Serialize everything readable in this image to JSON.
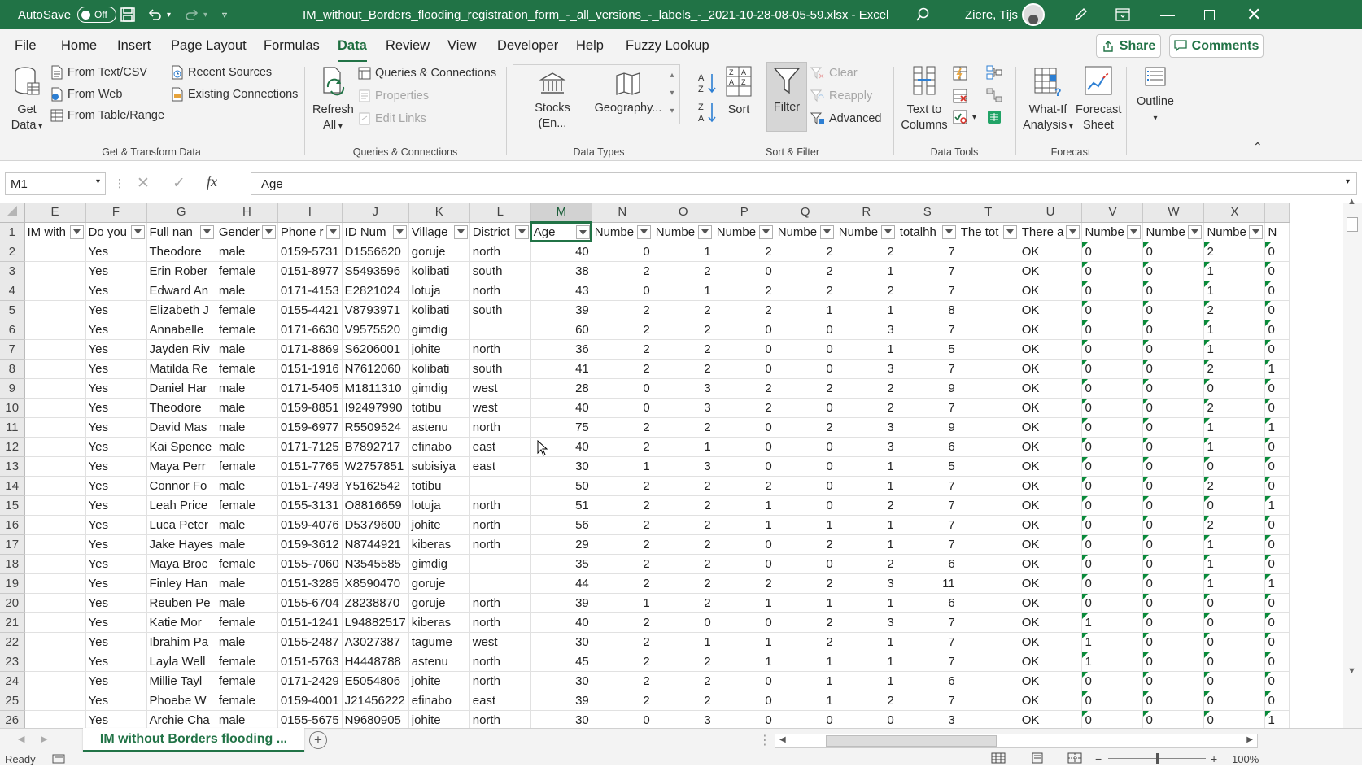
{
  "titlebar": {
    "autosave_label": "AutoSave",
    "autosave_state": "Off",
    "title": "IM_without_Borders_flooding_registration_form_-_all_versions_-_labels_-_2021-10-28-08-05-59.xlsx  -  Excel",
    "user": "Ziere, Tijs"
  },
  "menu": {
    "file": "File",
    "home": "Home",
    "insert": "Insert",
    "page_layout": "Page Layout",
    "formulas": "Formulas",
    "data": "Data",
    "review": "Review",
    "view": "View",
    "developer": "Developer",
    "help": "Help",
    "fuzzy": "Fuzzy Lookup",
    "share": "Share",
    "comments": "Comments"
  },
  "ribbon": {
    "get_data": [
      "Get",
      "Data"
    ],
    "from_text": "From Text/CSV",
    "from_web": "From Web",
    "from_table": "From Table/Range",
    "recent_sources": "Recent Sources",
    "existing_connections": "Existing Connections",
    "group_get": "Get & Transform Data",
    "refresh": [
      "Refresh",
      "All"
    ],
    "queries": "Queries & Connections",
    "properties": "Properties",
    "edit_links": "Edit Links",
    "group_queries": "Queries & Connections",
    "stocks": "Stocks (En...",
    "geography": "Geography...",
    "group_types": "Data Types",
    "sort": "Sort",
    "filter": "Filter",
    "clear": "Clear",
    "reapply": "Reapply",
    "advanced": "Advanced",
    "group_sort": "Sort & Filter",
    "text_to_columns": [
      "Text to",
      "Columns"
    ],
    "group_tools": "Data Tools",
    "what_if": [
      "What-If",
      "Analysis"
    ],
    "forecast_sheet": [
      "Forecast",
      "Sheet"
    ],
    "group_forecast": "Forecast",
    "outline": "Outline"
  },
  "formula_bar": {
    "name_box": "M1",
    "content": "Age"
  },
  "sheet": {
    "columns": [
      "E",
      "F",
      "G",
      "H",
      "I",
      "J",
      "K",
      "L",
      "M",
      "N",
      "O",
      "P",
      "Q",
      "R",
      "S",
      "T",
      "U",
      "V",
      "W",
      "X"
    ],
    "headers": [
      "IM with",
      "Do you",
      "Full nan",
      "Gender",
      "Phone r",
      "ID Num",
      "Village",
      "District",
      "Age",
      "Numbe",
      "Numbe",
      "Numbe",
      "Numbe",
      "Numbe",
      "totalhh",
      "The tot",
      "There a",
      "Numbe",
      "Numbe",
      "Numbe",
      "N"
    ],
    "rows": [
      {
        "n": "2",
        "c": [
          "",
          "Yes",
          "Theodore",
          "male",
          "0159-5731",
          "D1556620",
          "goruje",
          "north",
          "40",
          "0",
          "1",
          "2",
          "2",
          "2",
          "7",
          "",
          "OK",
          "0",
          "0",
          "2",
          "0"
        ]
      },
      {
        "n": "3",
        "c": [
          "",
          "Yes",
          "Erin Rober",
          "female",
          "0151-8977",
          "S5493596",
          "kolibati",
          "south",
          "38",
          "2",
          "2",
          "0",
          "2",
          "1",
          "7",
          "",
          "OK",
          "0",
          "0",
          "1",
          "0"
        ]
      },
      {
        "n": "4",
        "c": [
          "",
          "Yes",
          "Edward An",
          "male",
          "0171-4153",
          "E2821024",
          "lotuja",
          "north",
          "43",
          "0",
          "1",
          "2",
          "2",
          "2",
          "7",
          "",
          "OK",
          "0",
          "0",
          "1",
          "0"
        ]
      },
      {
        "n": "5",
        "c": [
          "",
          "Yes",
          "Elizabeth J",
          "female",
          "0155-4421",
          "V8793971",
          "kolibati",
          "south",
          "39",
          "2",
          "2",
          "2",
          "1",
          "1",
          "8",
          "",
          "OK",
          "0",
          "0",
          "2",
          "0"
        ]
      },
      {
        "n": "6",
        "c": [
          "",
          "Yes",
          "Annabelle",
          "female",
          "0171-6630",
          "V9575520",
          "gimdig",
          "",
          "60",
          "2",
          "2",
          "0",
          "0",
          "3",
          "7",
          "",
          "OK",
          "0",
          "0",
          "1",
          "0"
        ]
      },
      {
        "n": "7",
        "c": [
          "",
          "Yes",
          "Jayden Riv",
          "male",
          "0171-8869",
          "S6206001",
          "johite",
          "north",
          "36",
          "2",
          "2",
          "0",
          "0",
          "1",
          "5",
          "",
          "OK",
          "0",
          "0",
          "1",
          "0"
        ]
      },
      {
        "n": "8",
        "c": [
          "",
          "Yes",
          "Matilda Re",
          "female",
          "0151-1916",
          "N7612060",
          "kolibati",
          "south",
          "41",
          "2",
          "2",
          "0",
          "0",
          "3",
          "7",
          "",
          "OK",
          "0",
          "0",
          "2",
          "1"
        ]
      },
      {
        "n": "9",
        "c": [
          "",
          "Yes",
          "Daniel Har",
          "male",
          "0171-5405",
          "M1811310",
          "gimdig",
          "west",
          "28",
          "0",
          "3",
          "2",
          "2",
          "2",
          "9",
          "",
          "OK",
          "0",
          "0",
          "0",
          "0"
        ]
      },
      {
        "n": "10",
        "c": [
          "",
          "Yes",
          "Theodore",
          "male",
          "0159-8851",
          "I92497990",
          "totibu",
          "west",
          "40",
          "0",
          "3",
          "2",
          "0",
          "2",
          "7",
          "",
          "OK",
          "0",
          "0",
          "2",
          "0"
        ]
      },
      {
        "n": "11",
        "c": [
          "",
          "Yes",
          "David Mas",
          "male",
          "0159-6977",
          "R5509524",
          "astenu",
          "north",
          "75",
          "2",
          "2",
          "0",
          "2",
          "3",
          "9",
          "",
          "OK",
          "0",
          "0",
          "1",
          "1"
        ]
      },
      {
        "n": "12",
        "c": [
          "",
          "Yes",
          "Kai Spence",
          "male",
          "0171-7125",
          "B7892717",
          "efinabo",
          "east",
          "40",
          "2",
          "1",
          "0",
          "0",
          "3",
          "6",
          "",
          "OK",
          "0",
          "0",
          "1",
          "0"
        ]
      },
      {
        "n": "13",
        "c": [
          "",
          "Yes",
          "Maya Perr",
          "female",
          "0151-7765",
          "W2757851",
          "subisiya",
          "east",
          "30",
          "1",
          "3",
          "0",
          "0",
          "1",
          "5",
          "",
          "OK",
          "0",
          "0",
          "0",
          "0"
        ]
      },
      {
        "n": "14",
        "c": [
          "",
          "Yes",
          "Connor Fo",
          "male",
          "0151-7493",
          "Y5162542",
          "totibu",
          "",
          "50",
          "2",
          "2",
          "2",
          "0",
          "1",
          "7",
          "",
          "OK",
          "0",
          "0",
          "2",
          "0"
        ]
      },
      {
        "n": "15",
        "c": [
          "",
          "Yes",
          "Leah Price",
          "female",
          "0155-3131",
          "O8816659",
          "lotuja",
          "north",
          "51",
          "2",
          "2",
          "1",
          "0",
          "2",
          "7",
          "",
          "OK",
          "0",
          "0",
          "0",
          "1"
        ]
      },
      {
        "n": "16",
        "c": [
          "",
          "Yes",
          "Luca Peter",
          "male",
          "0159-4076",
          "D5379600",
          "johite",
          "north",
          "56",
          "2",
          "2",
          "1",
          "1",
          "1",
          "7",
          "",
          "OK",
          "0",
          "0",
          "2",
          "0"
        ]
      },
      {
        "n": "17",
        "c": [
          "",
          "Yes",
          "Jake Hayes",
          "male",
          "0159-3612",
          "N8744921",
          "kiberas",
          "north",
          "29",
          "2",
          "2",
          "0",
          "2",
          "1",
          "7",
          "",
          "OK",
          "0",
          "0",
          "1",
          "0"
        ]
      },
      {
        "n": "18",
        "c": [
          "",
          "Yes",
          "Maya Broc",
          "female",
          "0155-7060",
          "N3545585",
          "gimdig",
          "",
          "35",
          "2",
          "2",
          "0",
          "0",
          "2",
          "6",
          "",
          "OK",
          "0",
          "0",
          "1",
          "0"
        ]
      },
      {
        "n": "19",
        "c": [
          "",
          "Yes",
          "Finley Han",
          "male",
          "0151-3285",
          "X8590470",
          "goruje",
          "",
          "44",
          "2",
          "2",
          "2",
          "2",
          "3",
          "11",
          "",
          "OK",
          "0",
          "0",
          "1",
          "1"
        ]
      },
      {
        "n": "20",
        "c": [
          "",
          "Yes",
          "Reuben Pe",
          "male",
          "0155-6704",
          "Z8238870",
          "goruje",
          "north",
          "39",
          "1",
          "2",
          "1",
          "1",
          "1",
          "6",
          "",
          "OK",
          "0",
          "0",
          "0",
          "0"
        ]
      },
      {
        "n": "21",
        "c": [
          "",
          "Yes",
          "Katie Mor",
          "female",
          "0151-1241",
          "L94882517",
          "kiberas",
          "north",
          "40",
          "2",
          "0",
          "0",
          "2",
          "3",
          "7",
          "",
          "OK",
          "1",
          "0",
          "0",
          "0"
        ]
      },
      {
        "n": "22",
        "c": [
          "",
          "Yes",
          "Ibrahim Pa",
          "male",
          "0155-2487",
          "A3027387",
          "tagume",
          "west",
          "30",
          "2",
          "1",
          "1",
          "2",
          "1",
          "7",
          "",
          "OK",
          "1",
          "0",
          "0",
          "0"
        ]
      },
      {
        "n": "23",
        "c": [
          "",
          "Yes",
          "Layla Well",
          "female",
          "0151-5763",
          "H4448788",
          "astenu",
          "north",
          "45",
          "2",
          "2",
          "1",
          "1",
          "1",
          "7",
          "",
          "OK",
          "1",
          "0",
          "0",
          "0"
        ]
      },
      {
        "n": "24",
        "c": [
          "",
          "Yes",
          "Millie Tayl",
          "female",
          "0171-2429",
          "E5054806",
          "johite",
          "north",
          "30",
          "2",
          "2",
          "0",
          "1",
          "1",
          "6",
          "",
          "OK",
          "0",
          "0",
          "0",
          "0"
        ]
      },
      {
        "n": "25",
        "c": [
          "",
          "Yes",
          "Phoebe W",
          "female",
          "0159-4001",
          "J21456222",
          "efinabo",
          "east",
          "39",
          "2",
          "2",
          "0",
          "1",
          "2",
          "7",
          "",
          "OK",
          "0",
          "0",
          "0",
          "0"
        ]
      },
      {
        "n": "26",
        "c": [
          "",
          "Yes",
          "Archie Cha",
          "male",
          "0155-5675",
          "N9680905",
          "johite",
          "north",
          "30",
          "0",
          "3",
          "0",
          "0",
          "0",
          "3",
          "",
          "OK",
          "0",
          "0",
          "0",
          "1"
        ]
      }
    ]
  },
  "sheet_tab": "IM without Borders flooding ...",
  "status": {
    "mode": "Ready",
    "zoom": "100%"
  },
  "colors": {
    "accent": "#217346",
    "tab_text": "#1e6e3f"
  }
}
